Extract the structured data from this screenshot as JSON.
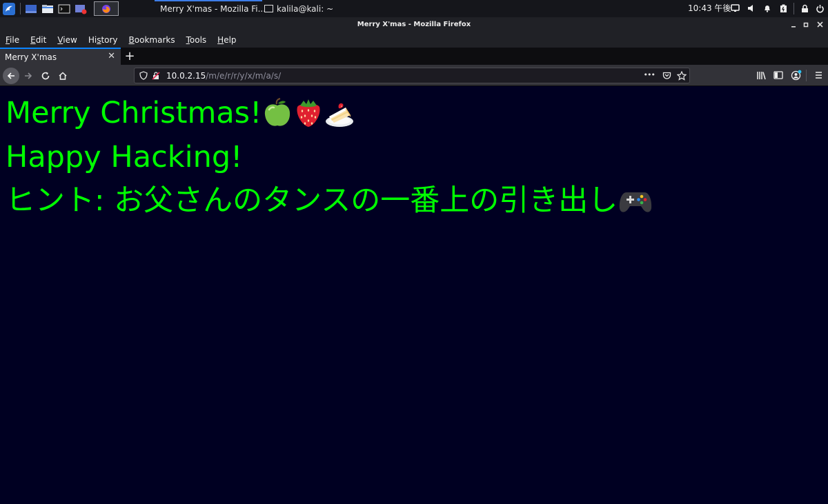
{
  "panel": {
    "tasks": [
      {
        "label": "Merry X'mas - Mozilla Fi...",
        "active": true
      },
      {
        "label": "kalila@kali: ~",
        "active": false
      }
    ],
    "clock": "10:43 午後"
  },
  "window": {
    "title": "Merry X'mas - Mozilla Firefox"
  },
  "menu": {
    "items": [
      {
        "pre": "",
        "u": "F",
        "post": "ile"
      },
      {
        "pre": "",
        "u": "E",
        "post": "dit"
      },
      {
        "pre": "",
        "u": "V",
        "post": "iew"
      },
      {
        "pre": "Hi",
        "u": "s",
        "post": "tory"
      },
      {
        "pre": "",
        "u": "B",
        "post": "ookmarks"
      },
      {
        "pre": "",
        "u": "T",
        "post": "ools"
      },
      {
        "pre": "",
        "u": "H",
        "post": "elp"
      }
    ]
  },
  "tab": {
    "title": "Merry X'mas",
    "close": "✕",
    "new_tab": "+"
  },
  "address": {
    "host": "10.0.2.15",
    "path": "/m/e/r/r/y/x/m/a/s/",
    "more": "•••"
  },
  "page": {
    "line1": "Merry Christmas!",
    "line2": "Happy Hacking!",
    "line3": "ヒント: お父さんのタンスの一番上の引き出し",
    "emoji1": "green-apple",
    "emoji2": "strawberry",
    "emoji3": "shortcake",
    "emoji4": "video-game"
  },
  "colors": {
    "page_bg": "#000022",
    "text": "#00ff00",
    "accent": "#0a84ff"
  }
}
